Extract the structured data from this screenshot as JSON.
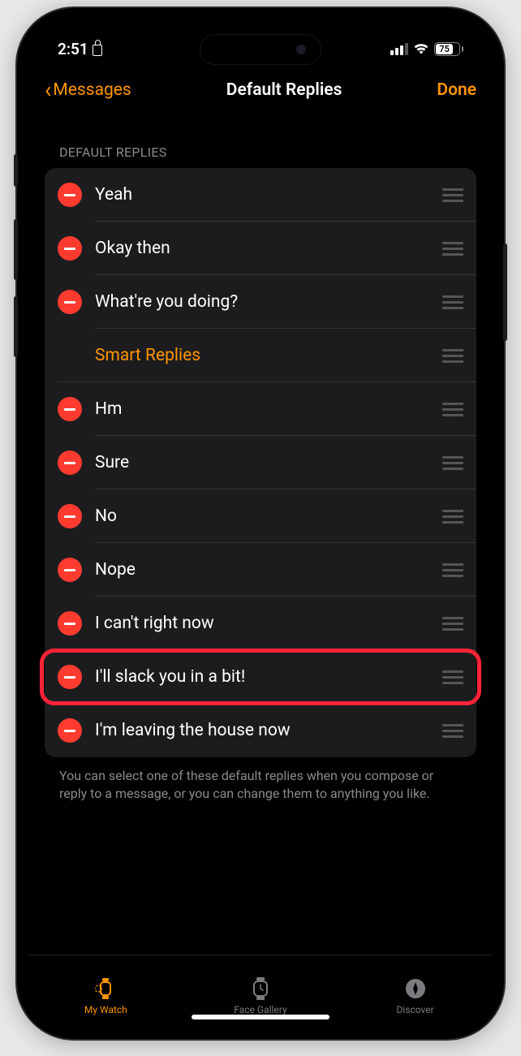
{
  "status": {
    "time": "2:51",
    "battery_pct": "75"
  },
  "nav": {
    "back_label": "Messages",
    "title": "Default Replies",
    "done_label": "Done"
  },
  "section_header": "DEFAULT REPLIES",
  "replies": [
    {
      "label": "Yeah",
      "deletable": true,
      "accent": false,
      "highlighted": false
    },
    {
      "label": "Okay then",
      "deletable": true,
      "accent": false,
      "highlighted": false
    },
    {
      "label": "What're you doing?",
      "deletable": true,
      "accent": false,
      "highlighted": false
    },
    {
      "label": "Smart Replies",
      "deletable": false,
      "accent": true,
      "highlighted": false
    },
    {
      "label": "Hm",
      "deletable": true,
      "accent": false,
      "highlighted": false
    },
    {
      "label": "Sure",
      "deletable": true,
      "accent": false,
      "highlighted": false
    },
    {
      "label": "No",
      "deletable": true,
      "accent": false,
      "highlighted": false
    },
    {
      "label": "Nope",
      "deletable": true,
      "accent": false,
      "highlighted": false
    },
    {
      "label": "I can't right now",
      "deletable": true,
      "accent": false,
      "highlighted": false
    },
    {
      "label": "I'll slack you in a bit!",
      "deletable": true,
      "accent": false,
      "highlighted": true
    },
    {
      "label": "I'm leaving the house now",
      "deletable": true,
      "accent": false,
      "highlighted": false
    }
  ],
  "footer_text": "You can select one of these default replies when you compose or reply to a message, or you can change them to anything you like.",
  "tabs": {
    "my_watch": "My Watch",
    "face_gallery": "Face Gallery",
    "discover": "Discover"
  },
  "colors": {
    "accent": "#ff9500",
    "delete": "#ff3b30",
    "highlight_ring": "#ff2438"
  }
}
